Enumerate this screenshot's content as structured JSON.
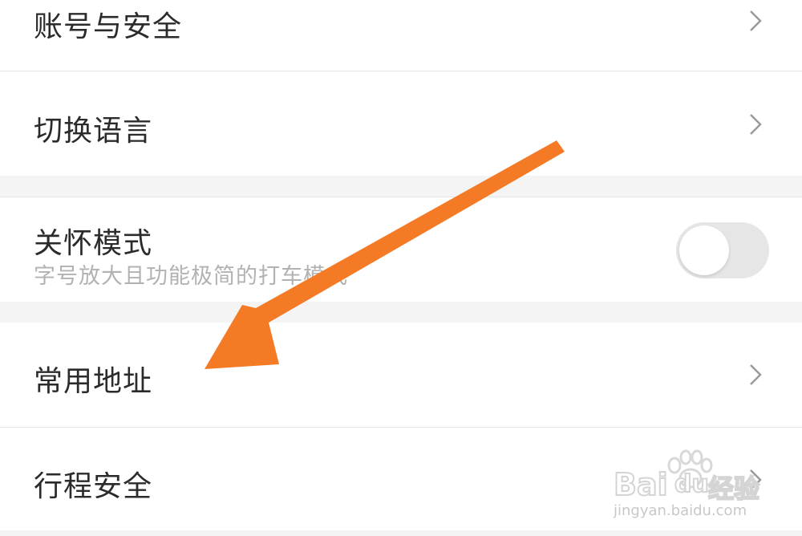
{
  "settings": {
    "account": {
      "label": "账号与安全"
    },
    "language": {
      "label": "切换语言"
    },
    "care_mode": {
      "label": "关怀模式",
      "description": "字号放大且功能极简的打车模式",
      "enabled": false
    },
    "addresses": {
      "label": "常用地址"
    },
    "trip_safety": {
      "label": "行程安全"
    }
  },
  "annotation": {
    "arrow_color": "#f47a26"
  },
  "watermark": {
    "brand": "Bai",
    "brand2": "du",
    "product": "经验",
    "url": "jingyan.baidu.com"
  },
  "colors": {
    "background": "#f4f4f4",
    "row": "#ffffff",
    "text": "#2b2b2b",
    "subtext": "#b2b2b2",
    "toggle_off": "#e6e6e6",
    "chevron": "#9a9a9a"
  },
  "icons": {
    "chevron": "chevron-right-icon",
    "watermark": "baidu-paw-icon"
  }
}
